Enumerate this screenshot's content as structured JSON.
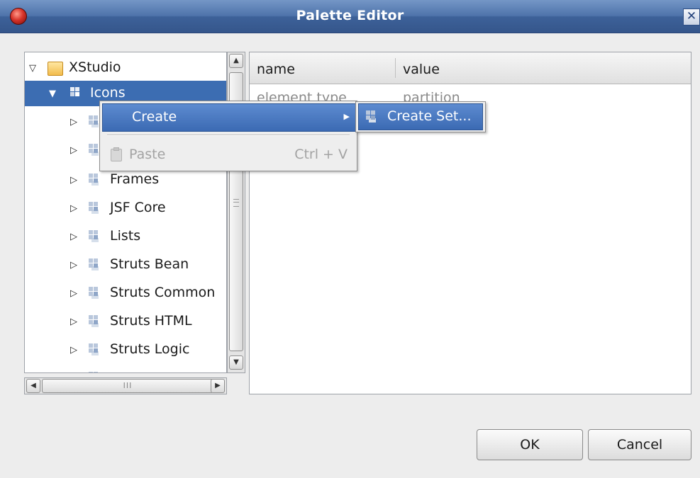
{
  "window": {
    "title": "Palette Editor",
    "close_glyph": "✕"
  },
  "tree": {
    "root": {
      "label": "XStudio",
      "expanded": true,
      "icon": "folder-icon"
    },
    "items": [
      {
        "label": "Icons",
        "selected": true,
        "expanded": true,
        "icon": "palette-set-icon"
      },
      {
        "label": "",
        "icon": "palette-set-icon"
      },
      {
        "label": "",
        "icon": "palette-set-icon"
      },
      {
        "label": "Frames",
        "icon": "palette-set-icon"
      },
      {
        "label": "JSF Core",
        "icon": "palette-set-icon"
      },
      {
        "label": "Lists",
        "icon": "palette-set-icon"
      },
      {
        "label": "Struts Bean",
        "icon": "palette-set-icon"
      },
      {
        "label": "Struts Common",
        "icon": "palette-set-icon"
      },
      {
        "label": "Struts HTML",
        "icon": "palette-set-icon"
      },
      {
        "label": "Struts Logic",
        "icon": "palette-set-icon"
      }
    ],
    "hscroll_grip": "III"
  },
  "properties": {
    "columns": [
      "name",
      "value"
    ],
    "rows": [
      {
        "name": "element type",
        "value": "partition"
      }
    ]
  },
  "context_menu": {
    "create_label": "Create",
    "paste_label": "Paste",
    "paste_shortcut": "Ctrl + V",
    "submenu": {
      "create_set_label": "Create Set..."
    }
  },
  "buttons": {
    "ok": "OK",
    "cancel": "Cancel"
  },
  "colors": {
    "selection": "#3c6db2",
    "titlebar": "#4f74ab"
  }
}
